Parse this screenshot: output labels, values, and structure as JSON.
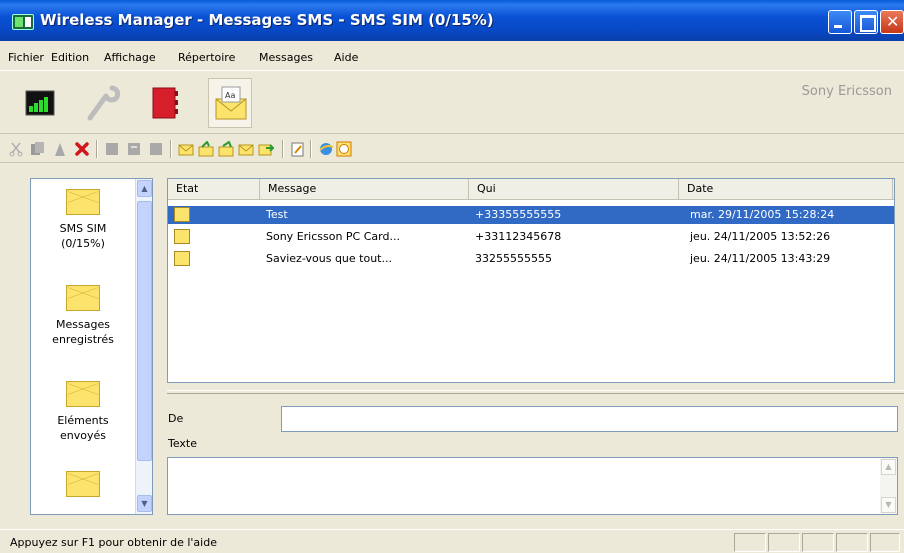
{
  "window": {
    "title": "Wireless Manager - Messages SMS - SMS SIM (0/15%)"
  },
  "menu": [
    "Fichier",
    "Edition",
    "Affichage",
    "Répertoire",
    "Messages",
    "Aide"
  ],
  "brand": "Sony Ericsson",
  "nav": {
    "items": [
      {
        "label": "SMS SIM",
        "sublabel": "(0/15%)",
        "icon": "sms-envelope-icon"
      },
      {
        "label": "Messages",
        "sublabel": "enregistrés",
        "icon": "saved-envelope-icon"
      },
      {
        "label": "Eléments",
        "sublabel": "envoyés",
        "icon": "sent-card-icon"
      },
      {
        "label": "",
        "sublabel": "",
        "icon": "card-icon"
      }
    ]
  },
  "list": {
    "columns": [
      "Etat",
      "Message",
      "Qui",
      "Date"
    ],
    "rows": [
      {
        "message": "Test",
        "qui": "+33355555555",
        "date": "mar. 29/11/2005 15:28:24",
        "selected": true
      },
      {
        "message": "Sony Ericsson PC Card...",
        "qui": "+33112345678",
        "date": "jeu. 24/11/2005 13:52:26",
        "selected": false
      },
      {
        "message": "Saviez-vous que tout...",
        "qui": "33255555555",
        "date": "jeu. 24/11/2005 13:43:29",
        "selected": false
      }
    ]
  },
  "detail": {
    "de_label": "De",
    "texte_label": "Texte",
    "de_value": "",
    "texte_value": ""
  },
  "status": {
    "text": "Appuyez sur F1 pour obtenir de l'aide"
  },
  "colors": {
    "title_bar": "#0a52d4",
    "selection": "#316ac5",
    "face": "#ece9d8"
  }
}
